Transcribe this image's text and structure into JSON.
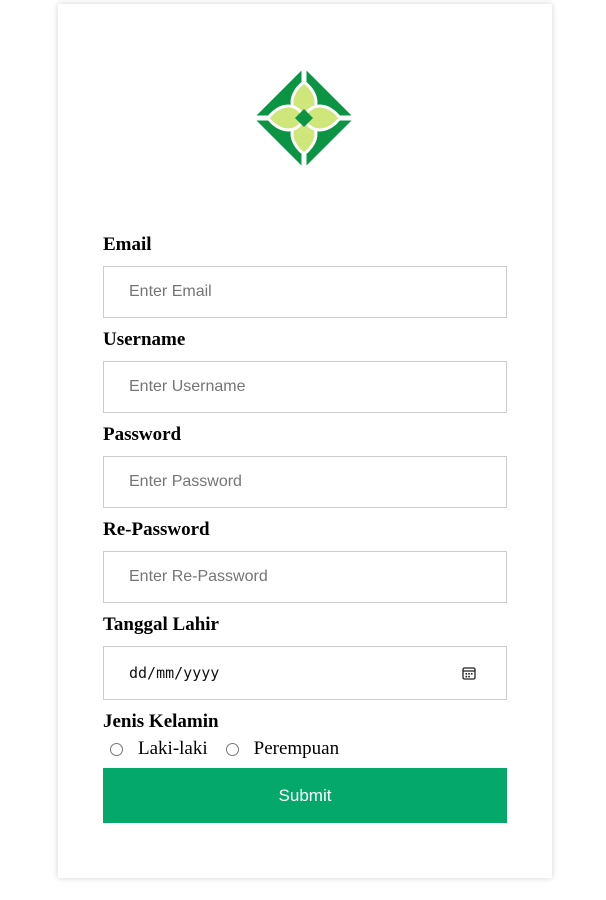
{
  "form": {
    "email": {
      "label": "Email",
      "placeholder": "Enter Email"
    },
    "username": {
      "label": "Username",
      "placeholder": "Enter Username"
    },
    "password": {
      "label": "Password",
      "placeholder": "Enter Password"
    },
    "repassword": {
      "label": "Re-Password",
      "placeholder": "Enter Re-Password"
    },
    "birthdate": {
      "label": "Tanggal Lahir",
      "value": "dd/mm/yyyy"
    },
    "gender": {
      "label": "Jenis Kelamin",
      "options": [
        "Laki-laki",
        "Perempuan"
      ]
    },
    "submit_label": "Submit"
  },
  "icons": {
    "logo": "logo-icon",
    "calendar": "calendar-icon"
  },
  "colors": {
    "logo_green": "#0a9444",
    "logo_light": "#cfe67a",
    "button": "#04a86a"
  }
}
